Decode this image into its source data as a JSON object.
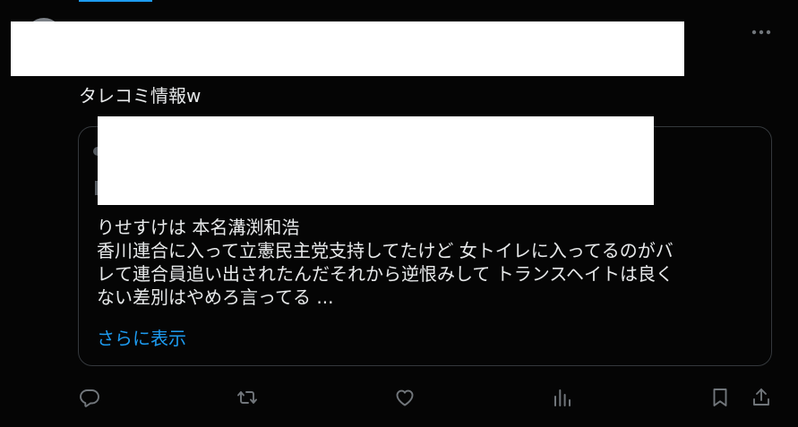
{
  "post": {
    "text": "タレコミ情報w"
  },
  "quote": {
    "lines": [
      "りせすけは 本名溝渕和浩",
      "香川連合に入って立憲民主党支持してたけど 女トイレに入ってるのがバ",
      "レて連合員追い出されたんだそれから逆恨みして トランスヘイトは良く",
      "ない差別はやめろ言ってる ..."
    ],
    "show_more": "さらに表示"
  },
  "colors": {
    "background": "#050505",
    "text": "#e7e9ea",
    "icon": "#71767b",
    "accent": "#1d9bf0",
    "border": "#34383c"
  },
  "icons": {
    "more": "more-horizontal-icon",
    "reply": "reply-icon",
    "repost": "repost-icon",
    "like": "like-icon",
    "views": "views-icon",
    "bookmark": "bookmark-icon",
    "share": "share-icon"
  }
}
